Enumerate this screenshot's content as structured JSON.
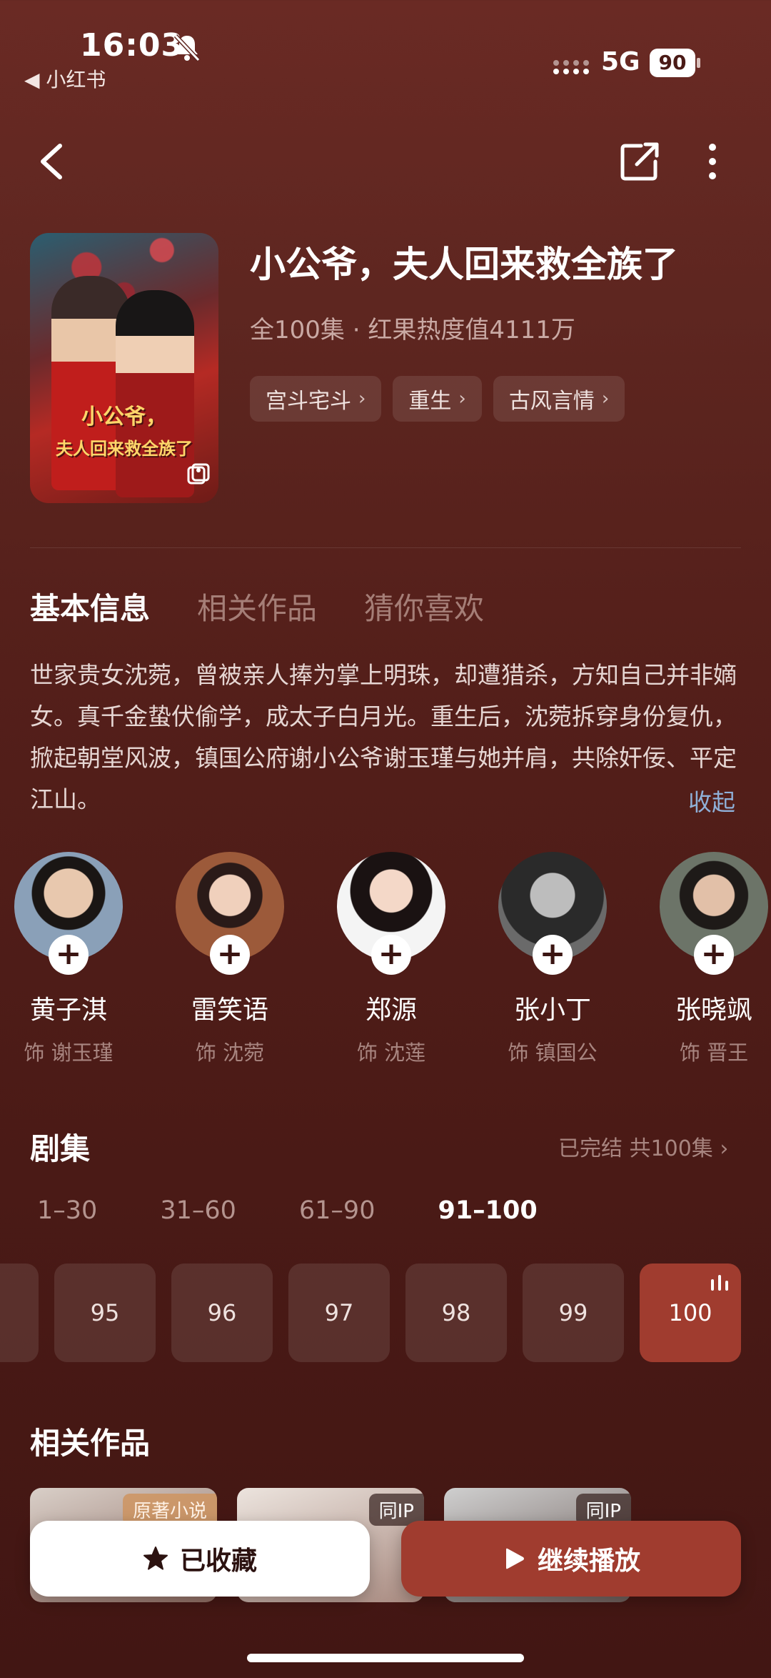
{
  "status_bar": {
    "time": "16:03",
    "back_app": "◀ 小红书",
    "network": "5G",
    "battery": "90"
  },
  "show": {
    "title": "小公爷，夫人回来救全族了",
    "info": "全100集 · 红果热度值4111万",
    "poster_title_line1": "小公爷，",
    "poster_title_line2": "夫人回来救全族了",
    "tags": [
      "宫斗宅斗",
      "重生",
      "古风言情"
    ]
  },
  "tabs": [
    "基本信息",
    "相关作品",
    "猜你喜欢"
  ],
  "synopsis": "世家贵女沈菀，曾被亲人捧为掌上明珠，却遭猎杀，方知自己并非嫡女。真千金蛰伏偷学，成太子白月光。重生后，沈菀拆穿身份复仇，掀起朝堂风波，镇国公府谢小公爷谢玉瑾与她并肩，共除奸佞、平定江山。",
  "collapse_label": "收起",
  "cast": [
    {
      "name": "黄子淇",
      "role": "饰 谢玉瑾"
    },
    {
      "name": "雷笑语",
      "role": "饰 沈菀"
    },
    {
      "name": "郑源",
      "role": "饰 沈莲"
    },
    {
      "name": "张小丁",
      "role": "饰 镇国公"
    },
    {
      "name": "张晓飒",
      "role": "饰 晋王"
    }
  ],
  "episodes": {
    "title": "剧集",
    "status": "已完结 共100集",
    "ranges": [
      "1–30",
      "31–60",
      "61–90",
      "91–100"
    ],
    "tiles": [
      "95",
      "96",
      "97",
      "98",
      "99",
      "100"
    ]
  },
  "related": {
    "title": "相关作品",
    "badges": [
      "原著小说",
      "同IP",
      "同IP"
    ]
  },
  "actions": {
    "fav_label": "已收藏",
    "play_label": "继续播放"
  },
  "colors": {
    "accent": "#a03c2f",
    "link": "#8fb0d8"
  }
}
